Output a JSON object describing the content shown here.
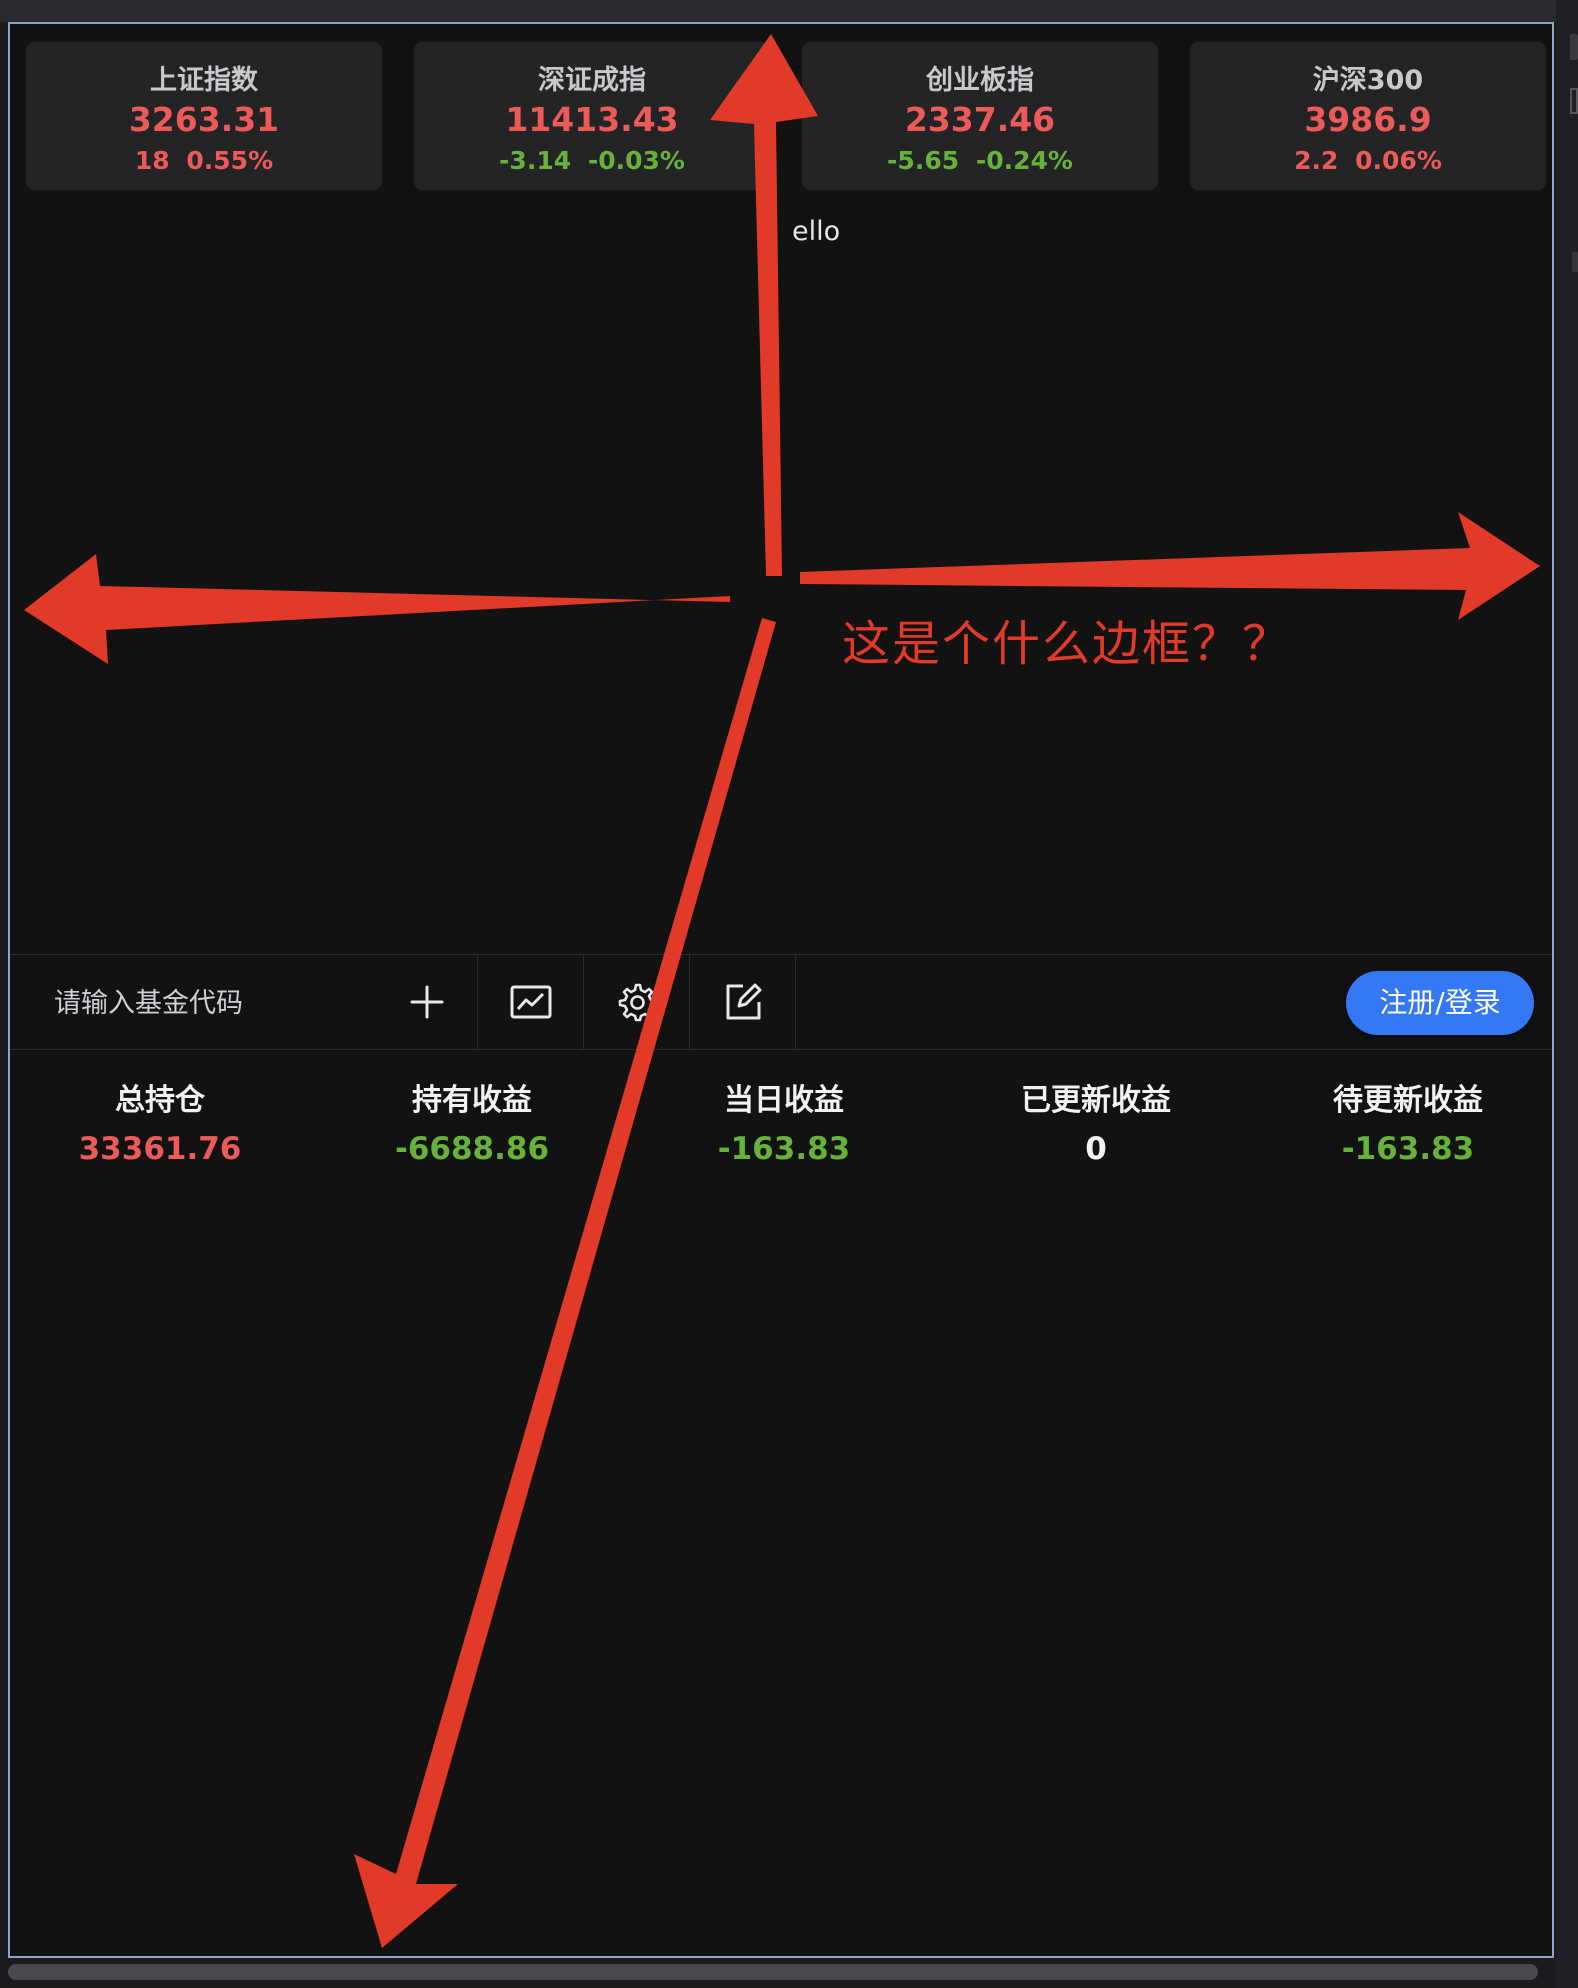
{
  "indices": [
    {
      "name": "上证指数",
      "value": "3263.31",
      "change": "18",
      "percent": "0.55%",
      "trend": "up"
    },
    {
      "name": "深证成指",
      "value": "11413.43",
      "change": "-3.14",
      "percent": "-0.03%",
      "trend": "down"
    },
    {
      "name": "创业板指",
      "value": "2337.46",
      "change": "-5.65",
      "percent": "-0.24%",
      "trend": "down"
    },
    {
      "name": "沪深300",
      "value": "3986.9",
      "change": "2.2",
      "percent": "0.06%",
      "trend": "up"
    }
  ],
  "hello_text": "ello",
  "toolbar": {
    "input_placeholder": "请输入基金代码",
    "add_icon": "plus-icon",
    "chart_icon": "line-chart-icon",
    "settings_icon": "gear-icon",
    "edit_icon": "edit-icon",
    "login_label": "注册/登录"
  },
  "summary": [
    {
      "label": "总持仓",
      "value": "33361.76",
      "trend": "up"
    },
    {
      "label": "持有收益",
      "value": "-6688.86",
      "trend": "down"
    },
    {
      "label": "当日收益",
      "value": "-163.83",
      "trend": "down"
    },
    {
      "label": "已更新收益",
      "value": "0",
      "trend": "neutral"
    },
    {
      "label": "待更新收益",
      "value": "-163.83",
      "trend": "down"
    }
  ],
  "annotation": {
    "text": "这是个什么边框？？",
    "color": "#e23a28"
  },
  "colors": {
    "up": "#ec5a5a",
    "down": "#67b23a",
    "accent": "#3478f6",
    "frame_border": "#8aa6c8"
  }
}
